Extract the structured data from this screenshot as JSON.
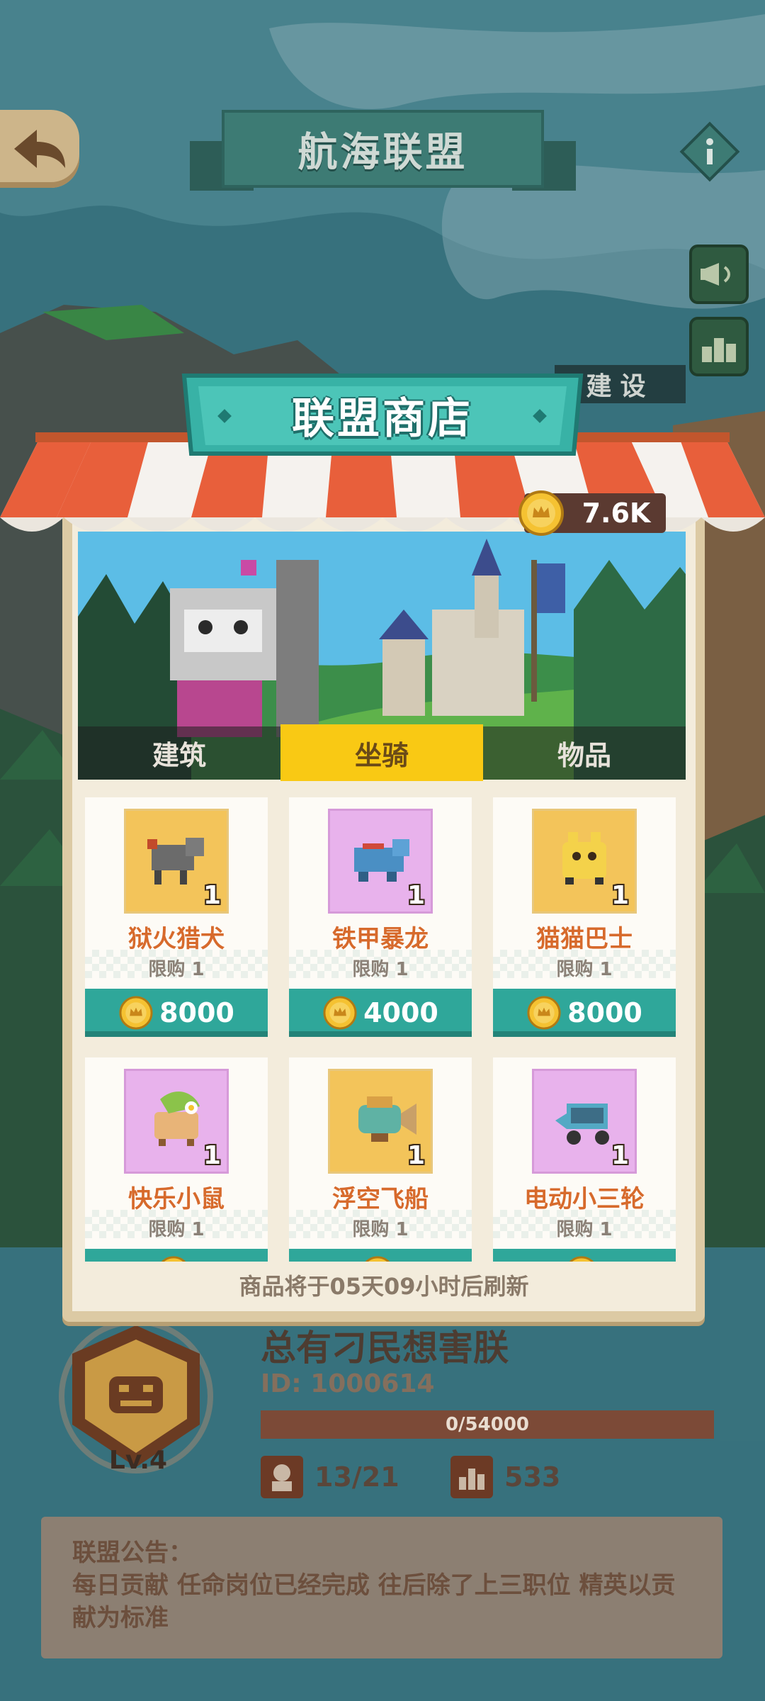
{
  "header": {
    "title": "航海联盟",
    "build_label": "建设"
  },
  "shop": {
    "title": "联盟商店",
    "currency_value": "7.6K",
    "tabs": [
      {
        "label": "建筑",
        "selected": false
      },
      {
        "label": "坐骑",
        "selected": true
      },
      {
        "label": "物品",
        "selected": false
      }
    ],
    "items": [
      {
        "name": "狱火猎犬",
        "qty": "1",
        "limit": "限购 1",
        "price": "8000",
        "bg": "gold"
      },
      {
        "name": "铁甲暴龙",
        "qty": "1",
        "limit": "限购 1",
        "price": "4000",
        "bg": "pink"
      },
      {
        "name": "猫猫巴士",
        "qty": "1",
        "limit": "限购 1",
        "price": "8000",
        "bg": "gold"
      },
      {
        "name": "快乐小鼠",
        "qty": "1",
        "limit": "限购 1",
        "price": "",
        "bg": "pink"
      },
      {
        "name": "浮空飞船",
        "qty": "1",
        "limit": "限购 1",
        "price": "",
        "bg": "gold"
      },
      {
        "name": "电动小三轮",
        "qty": "1",
        "limit": "限购 1",
        "price": "",
        "bg": "pink"
      }
    ],
    "refresh_text": "商品将于05天09小时后刷新"
  },
  "alliance": {
    "name": "总有刁民想害朕",
    "id": "ID: 1000614",
    "level": "Lv.4",
    "progress_text": "0/54000",
    "progress_fraction": 0,
    "members": "13/21",
    "power": "533",
    "notice_title": "联盟公告：",
    "notice_text": "每日贡献 任命岗位已经完成  往后除了上三职位 精英以贡献为标准"
  },
  "colors": {
    "teal": "#2fa79a",
    "tab_selected": "#f9c914",
    "item_name": "#d76a2c",
    "coin": "#f5c232"
  },
  "icons": [
    "back-arrow-icon",
    "info-icon",
    "megaphone-icon",
    "ranking-icon",
    "coin-icon",
    "members-icon",
    "power-icon",
    "alliance-emblem-icon"
  ]
}
